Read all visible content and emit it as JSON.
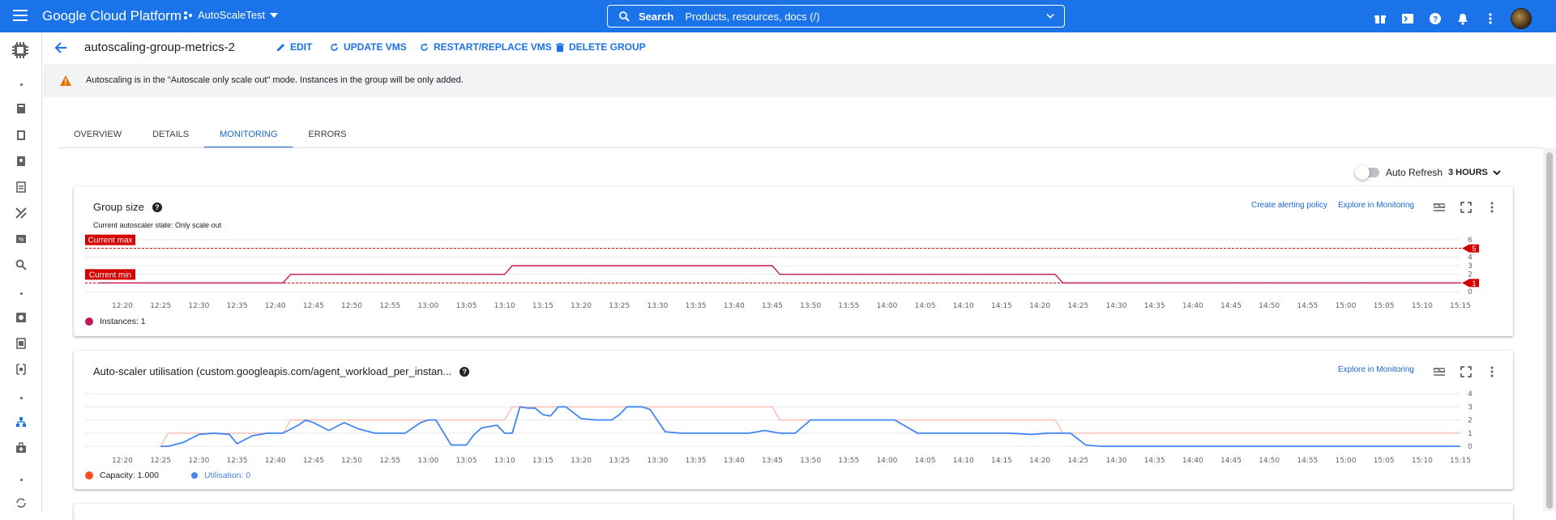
{
  "topbar": {
    "brand": "Google Cloud Platform",
    "project": "AutoScaleTest",
    "search_label": "Search",
    "search_placeholder": "Products, resources, docs (/)"
  },
  "header": {
    "title": "autoscaling-group-metrics-2",
    "actions": [
      "EDIT",
      "UPDATE VMS",
      "RESTART/REPLACE VMS",
      "DELETE GROUP"
    ]
  },
  "banner": {
    "text": "Autoscaling is in the \"Autoscale only scale out\" mode. Instances in the group will be only added."
  },
  "tabs": [
    "OVERVIEW",
    "DETAILS",
    "MONITORING",
    "ERRORS"
  ],
  "active_tab": "MONITORING",
  "controls": {
    "auto_refresh_label": "Auto Refresh",
    "range_label": "3 HOURS"
  },
  "colors": {
    "brand_blue": "#1a73e8",
    "group_size_line": "#c2185b",
    "capacity": "#f4511e",
    "utilisation": "#4285f4",
    "current_limits": "#d50000"
  },
  "group_card": {
    "title": "Group size",
    "subtitle": "Current autoscaler state: Only scale out",
    "alert_link": "Create alerting policy",
    "explore_link": "Explore in Monitoring",
    "current_max_label": "Current max",
    "current_min_label": "Current min",
    "max_marker": "5",
    "min_marker": "1",
    "legend_label": "Instances: 1"
  },
  "util_card": {
    "title": "Auto-scaler utilisation (custom.googleapis.com/agent_workload_per_instan...",
    "explore_link": "Explore in Monitoring",
    "capacity_legend": "Capacity: 1.000",
    "util_legend": "Utilisation: 0"
  },
  "chart_data": [
    {
      "type": "line",
      "title": "Group size",
      "x_ticks": [
        "12:20",
        "12:25",
        "12:30",
        "12:35",
        "12:40",
        "12:45",
        "12:50",
        "12:55",
        "13:00",
        "13:05",
        "13:10",
        "13:15",
        "13:20",
        "13:25",
        "13:30",
        "13:35",
        "13:40",
        "13:45",
        "13:50",
        "13:55",
        "14:00",
        "14:05",
        "14:10",
        "14:15",
        "14:20",
        "14:25",
        "14:30",
        "14:35",
        "14:40",
        "14:45",
        "14:50",
        "14:55",
        "15:00",
        "15:05",
        "15:10",
        "15:15"
      ],
      "y_ticks": [
        0,
        1,
        2,
        3,
        4,
        5,
        6
      ],
      "ylim": [
        0,
        6
      ],
      "reference_lines": [
        {
          "name": "Current max",
          "value": 5
        },
        {
          "name": "Current min",
          "value": 1
        }
      ],
      "series": [
        {
          "name": "Instances",
          "x": [
            "12:17",
            "12:41",
            "12:42",
            "13:10",
            "13:11",
            "13:45",
            "13:46",
            "14:22",
            "14:23",
            "15:15"
          ],
          "values": [
            1,
            1,
            2,
            2,
            3,
            3,
            2,
            2,
            1,
            1
          ]
        }
      ]
    },
    {
      "type": "line",
      "title": "Auto-scaler utilisation (custom.googleapis.com/agent_workload_per_instan...",
      "x_ticks": [
        "12:20",
        "12:25",
        "12:30",
        "12:35",
        "12:40",
        "12:45",
        "12:50",
        "12:55",
        "13:00",
        "13:05",
        "13:10",
        "13:15",
        "13:20",
        "13:25",
        "13:30",
        "13:35",
        "13:40",
        "13:45",
        "13:50",
        "13:55",
        "14:00",
        "14:05",
        "14:10",
        "14:15",
        "14:20",
        "14:25",
        "14:30",
        "14:35",
        "14:40",
        "14:45",
        "14:50",
        "14:55",
        "15:00",
        "15:05",
        "15:10",
        "15:15"
      ],
      "y_ticks": [
        0,
        1,
        2,
        3,
        4
      ],
      "ylim": [
        0,
        4
      ],
      "series": [
        {
          "name": "Capacity",
          "x": [
            "12:25",
            "12:26",
            "12:41",
            "12:42",
            "13:10",
            "13:11",
            "13:45",
            "13:46",
            "14:22",
            "14:23",
            "15:15"
          ],
          "values": [
            0,
            1,
            1,
            2,
            2,
            3,
            3,
            2,
            2,
            1,
            1
          ]
        },
        {
          "name": "Utilisation",
          "x": [
            "12:25",
            "12:26",
            "12:28",
            "12:30",
            "12:32",
            "12:34",
            "12:35",
            "12:37",
            "12:39",
            "12:41",
            "12:43",
            "12:44",
            "12:45",
            "12:47",
            "12:49",
            "12:51",
            "12:53",
            "12:55",
            "12:57",
            "12:59",
            "13:00",
            "13:01",
            "13:03",
            "13:05",
            "13:06",
            "13:07",
            "13:09",
            "13:10",
            "13:11",
            "13:12",
            "13:13",
            "13:14",
            "13:15",
            "13:16",
            "13:17",
            "13:18",
            "13:20",
            "13:22",
            "13:24",
            "13:25",
            "13:26",
            "13:28",
            "13:29",
            "13:31",
            "13:33",
            "13:36",
            "13:39",
            "13:42",
            "13:44",
            "13:46",
            "13:48",
            "13:50",
            "13:52",
            "13:53",
            "13:55",
            "13:58",
            "14:01",
            "14:04",
            "14:06",
            "14:08",
            "14:10",
            "14:13",
            "14:16",
            "14:19",
            "14:21",
            "14:23",
            "14:24",
            "14:26",
            "14:28",
            "14:30",
            "15:15"
          ],
          "values": [
            0,
            0,
            0.3,
            0.9,
            1,
            0.9,
            0.2,
            0.8,
            1,
            1,
            1.6,
            2,
            1.8,
            1.2,
            1.8,
            1.3,
            1,
            1,
            1,
            1.8,
            2,
            2,
            0.1,
            0.1,
            0.9,
            1.4,
            1.6,
            1,
            1,
            3,
            2.9,
            2.9,
            2.4,
            2.3,
            3,
            3,
            2.1,
            2,
            2,
            2.4,
            3,
            3,
            2.8,
            1.1,
            1,
            1,
            1,
            1,
            1.2,
            1,
            1,
            2,
            2,
            2,
            2,
            2,
            2,
            1,
            1,
            1,
            1,
            1,
            1,
            0.9,
            1,
            1,
            1,
            0.1,
            0,
            0,
            0
          ]
        }
      ]
    }
  ]
}
